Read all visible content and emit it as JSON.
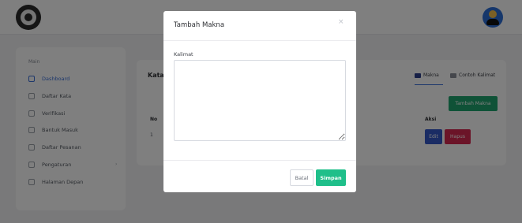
{
  "sidebar": {
    "heading": "Main",
    "items": [
      {
        "label": "Dashboard",
        "icon": "dashboard-icon"
      },
      {
        "label": "Daftar Kata",
        "icon": "list-icon"
      },
      {
        "label": "Verifikasi",
        "icon": "verify-icon"
      },
      {
        "label": "Bantuk Masuk",
        "icon": "inbox-icon"
      },
      {
        "label": "Daftar Pesanan",
        "icon": "search-icon"
      },
      {
        "label": "Pengaturan",
        "icon": "gear-icon"
      },
      {
        "label": "Halaman Depan",
        "icon": "home-icon"
      }
    ]
  },
  "content": {
    "title": "Kata",
    "tabs": [
      {
        "label": "Makna",
        "icon": "book-icon"
      },
      {
        "label": "Contoh Kalimat",
        "icon": "grid-icon"
      }
    ],
    "add_button": "Tambah Makna",
    "table": {
      "headers": [
        "No",
        "Aksi"
      ],
      "rows": [
        {
          "no": "1",
          "edit": "Edit",
          "delete": "Hapus"
        }
      ]
    }
  },
  "modal": {
    "title": "Tambah Makna",
    "close_symbol": "×",
    "field_label": "Kalimat",
    "field_value": "",
    "cancel_label": "Batal",
    "save_label": "Simpan"
  },
  "colors": {
    "accent": "#3a6fd8",
    "primary_green": "#1fbf8a",
    "add_green": "#1ea56f",
    "edit_blue": "#3559c9",
    "delete_red": "#d62850"
  }
}
